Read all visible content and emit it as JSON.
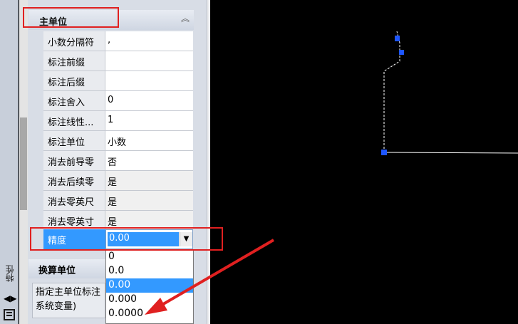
{
  "palette": {
    "title": "特性",
    "collapse_icon": "double-chevron-up-icon"
  },
  "section_primary": {
    "title": "主单位",
    "rows": [
      {
        "name": "小数分隔符",
        "value": ","
      },
      {
        "name": "标注前缀",
        "value": ""
      },
      {
        "name": "标注后缀",
        "value": ""
      },
      {
        "name": "标注舍入",
        "value": "0"
      },
      {
        "name": "标注线性...",
        "value": "1"
      },
      {
        "name": "标注单位",
        "value": "小数"
      },
      {
        "name": "消去前导零",
        "value": "否"
      },
      {
        "name": "消去后续零",
        "value": "是"
      },
      {
        "name": "消去零英尺",
        "value": "是"
      },
      {
        "name": "消去零英寸",
        "value": "是"
      }
    ],
    "precision": {
      "name": "精度",
      "value": "0.00"
    }
  },
  "precision_options": [
    "0",
    "0.0",
    "0.00",
    "0.000",
    "0.0000"
  ],
  "selected_option": "0.00",
  "section_alt": {
    "title": "换算单位"
  },
  "description": "指定主单位标注 系统变量)",
  "colors": {
    "highlight": "#3399ff",
    "annotation": "#e02020",
    "grip": "#1e56ff"
  }
}
